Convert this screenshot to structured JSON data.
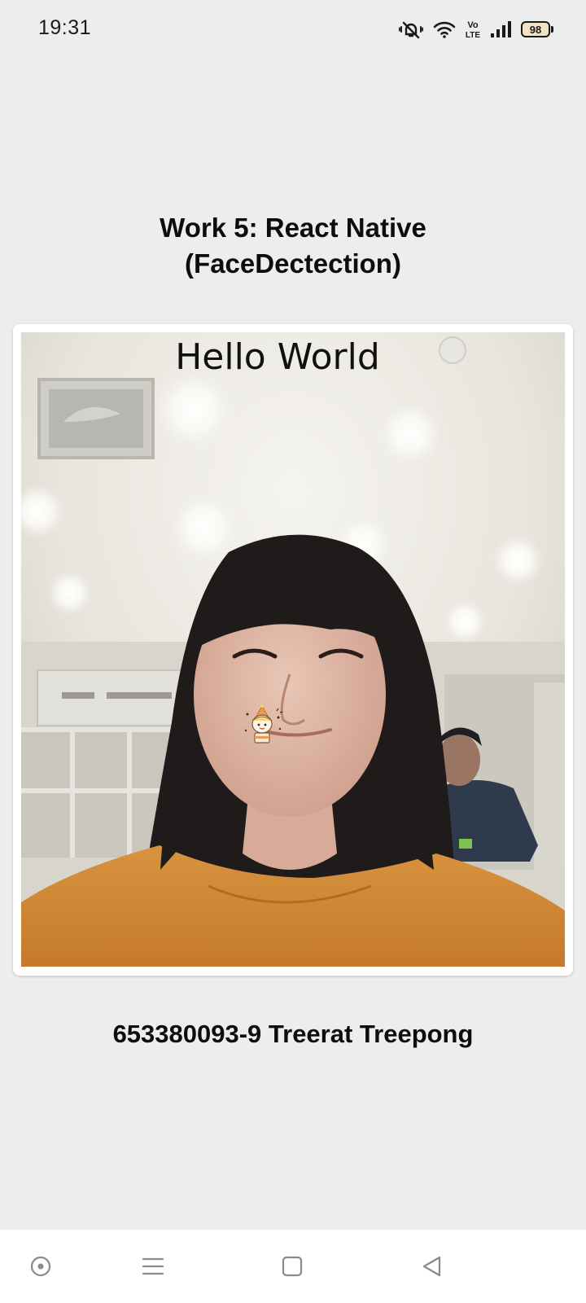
{
  "status_bar": {
    "time": "19:31",
    "network_label": "Vo LTE",
    "battery_level": "98",
    "icons": [
      "vibrate-mute-icon",
      "wifi-icon",
      "volte-icon",
      "signal-icon",
      "battery-icon"
    ]
  },
  "page": {
    "title_line1": "Work 5: React Native",
    "title_line2": "(FaceDectection)",
    "student_info": "653380093-9 Treerat Treepong"
  },
  "camera": {
    "overlay_text": "Hello World",
    "sticker": "face-sticker-icon"
  },
  "nav_bar": {
    "buttons": [
      "assistant-icon",
      "menu-icon",
      "home-icon",
      "back-icon"
    ]
  },
  "colors": {
    "background": "#ebeeed",
    "card": "#ffffff",
    "text": "#0d0d0d",
    "battery_fill": "#f0e2c4"
  }
}
